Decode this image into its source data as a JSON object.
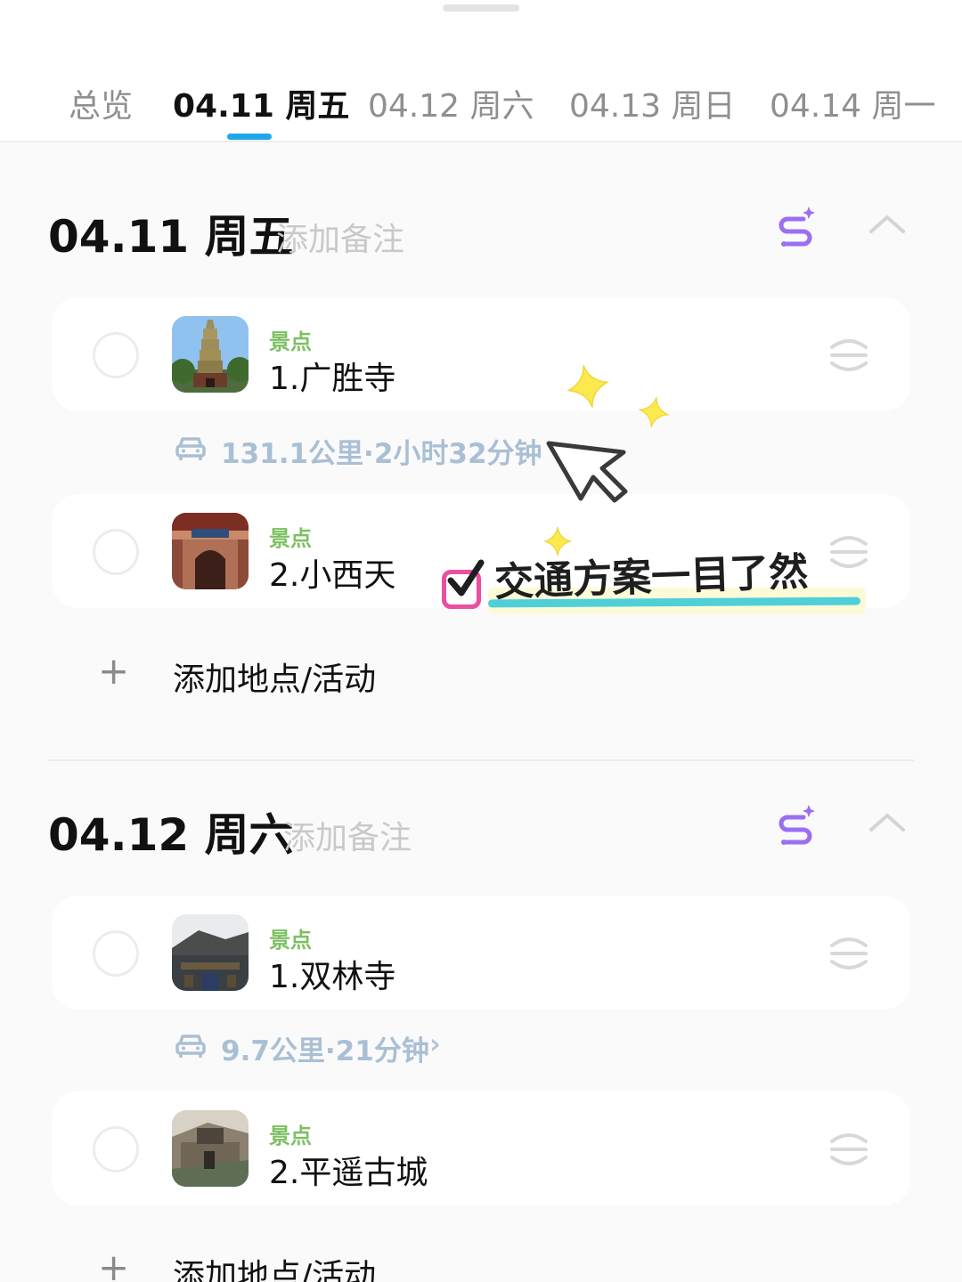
{
  "tabs": [
    {
      "label": "总览"
    },
    {
      "label": "04.11 周五",
      "active": true
    },
    {
      "label": "04.12 周六"
    },
    {
      "label": "04.13 周日"
    },
    {
      "label": "04.14 周一"
    }
  ],
  "days": [
    {
      "title": "04.11 周五",
      "note_placeholder": "添加备注",
      "items": [
        {
          "category": "景点",
          "name": "1.广胜寺"
        },
        {
          "category": "景点",
          "name": "2.小西天"
        }
      ],
      "transport": {
        "text": "131.1公里·2小时32分钟"
      },
      "add_label": "添加地点/活动"
    },
    {
      "title": "04.12 周六",
      "note_placeholder": "添加备注",
      "items": [
        {
          "category": "景点",
          "name": "1.双林寺"
        },
        {
          "category": "景点",
          "name": "2.平遥古城"
        }
      ],
      "transport": {
        "text": "9.7公里·21分钟",
        "chevron": "›"
      },
      "add_label": "添加地点/活动"
    }
  ],
  "annotation": {
    "caption": "交通方案一目了然"
  },
  "colors": {
    "tab_indicator": "#1ea7e8",
    "category_green": "#7cc063",
    "transport_text": "#a9bfd4",
    "ai_icon_purple": "#9b6ef3",
    "highlight_cyan": "#4fd0d9",
    "doodle_pink": "#ea4fa0",
    "sparkle_yellow": "#fbe94d"
  },
  "icons": {
    "ai_route": "ai-route-icon",
    "collapse": "chevron-up-icon",
    "drag": "drag-handle-icon",
    "car": "car-icon",
    "add": "plus-icon"
  }
}
